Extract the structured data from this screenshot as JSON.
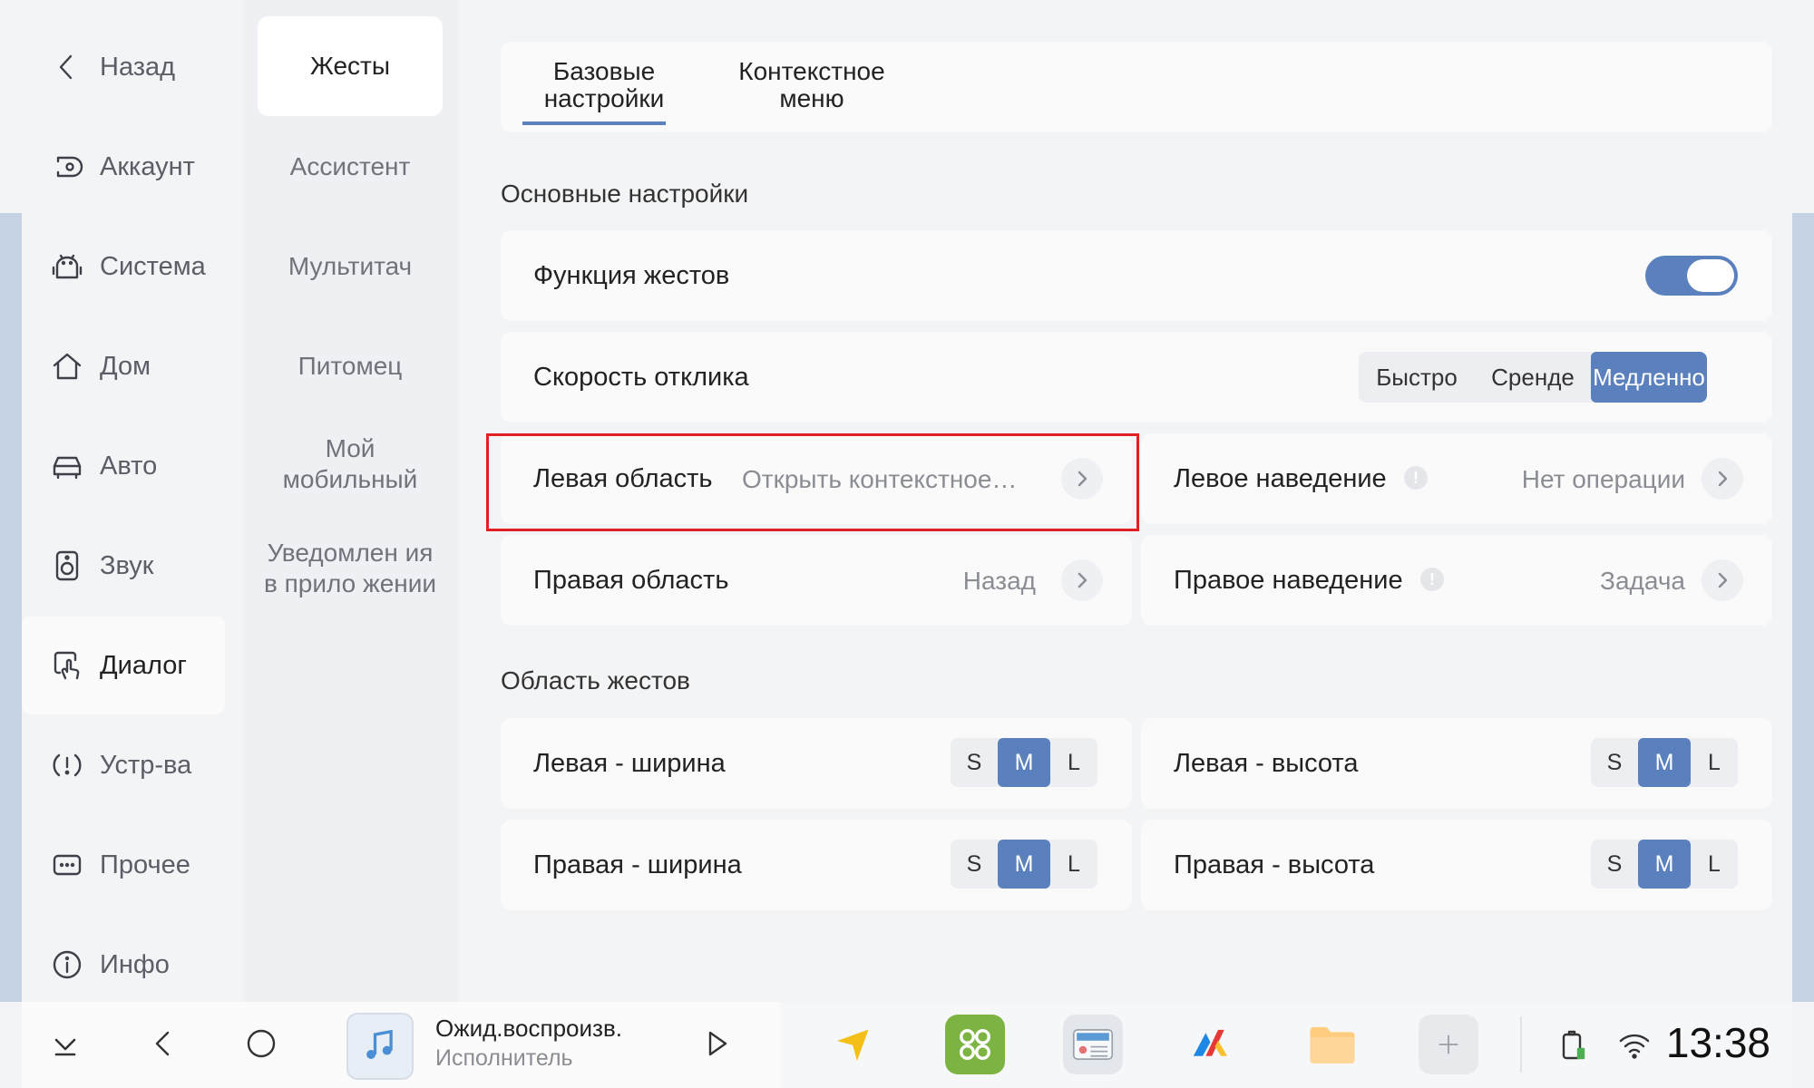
{
  "nav": {
    "back": "Назад",
    "items": [
      "Аккаунт",
      "Система",
      "Дом",
      "Авто",
      "Звук",
      "Диалог",
      "Устр-ва",
      "Прочее",
      "Инфо"
    ],
    "active": "Диалог"
  },
  "subnav": {
    "items": [
      "Жесты",
      "Ассистент",
      "Мультитач",
      "Питомец",
      "Мой мобильный",
      "Уведомлен ия в прило жении"
    ],
    "active": "Жесты"
  },
  "tabs": {
    "basic": "Базовые настройки",
    "context": "Контекстное меню"
  },
  "main": {
    "section_main": "Основные настройки",
    "gesture_function": "Функция жестов",
    "gesture_function_on": true,
    "response_speed": "Скорость отклика",
    "speed_options": [
      "Быстро",
      "Сренде",
      "Медленно"
    ],
    "speed_selected": "Медленно",
    "left_area": "Левая область",
    "left_area_value": "Открыть контекстное…",
    "left_hover": "Левое наведение",
    "left_hover_value": "Нет операции",
    "right_area": "Правая область",
    "right_area_value": "Назад",
    "right_hover": "Правое наведение",
    "right_hover_value": "Задача",
    "section_area": "Область жестов",
    "left_width": "Левая - ширина",
    "left_height": "Левая - высота",
    "right_width": "Правая - ширина",
    "right_height": "Правая - высота",
    "size_options": [
      "S",
      "M",
      "L"
    ],
    "size_selected": "M"
  },
  "taskbar": {
    "track_title": "Ожид.воспроизв.",
    "track_artist": "Исполнитель",
    "time": "13:38"
  },
  "colors": {
    "accent": "#5a80be",
    "highlight": "#e02025"
  }
}
